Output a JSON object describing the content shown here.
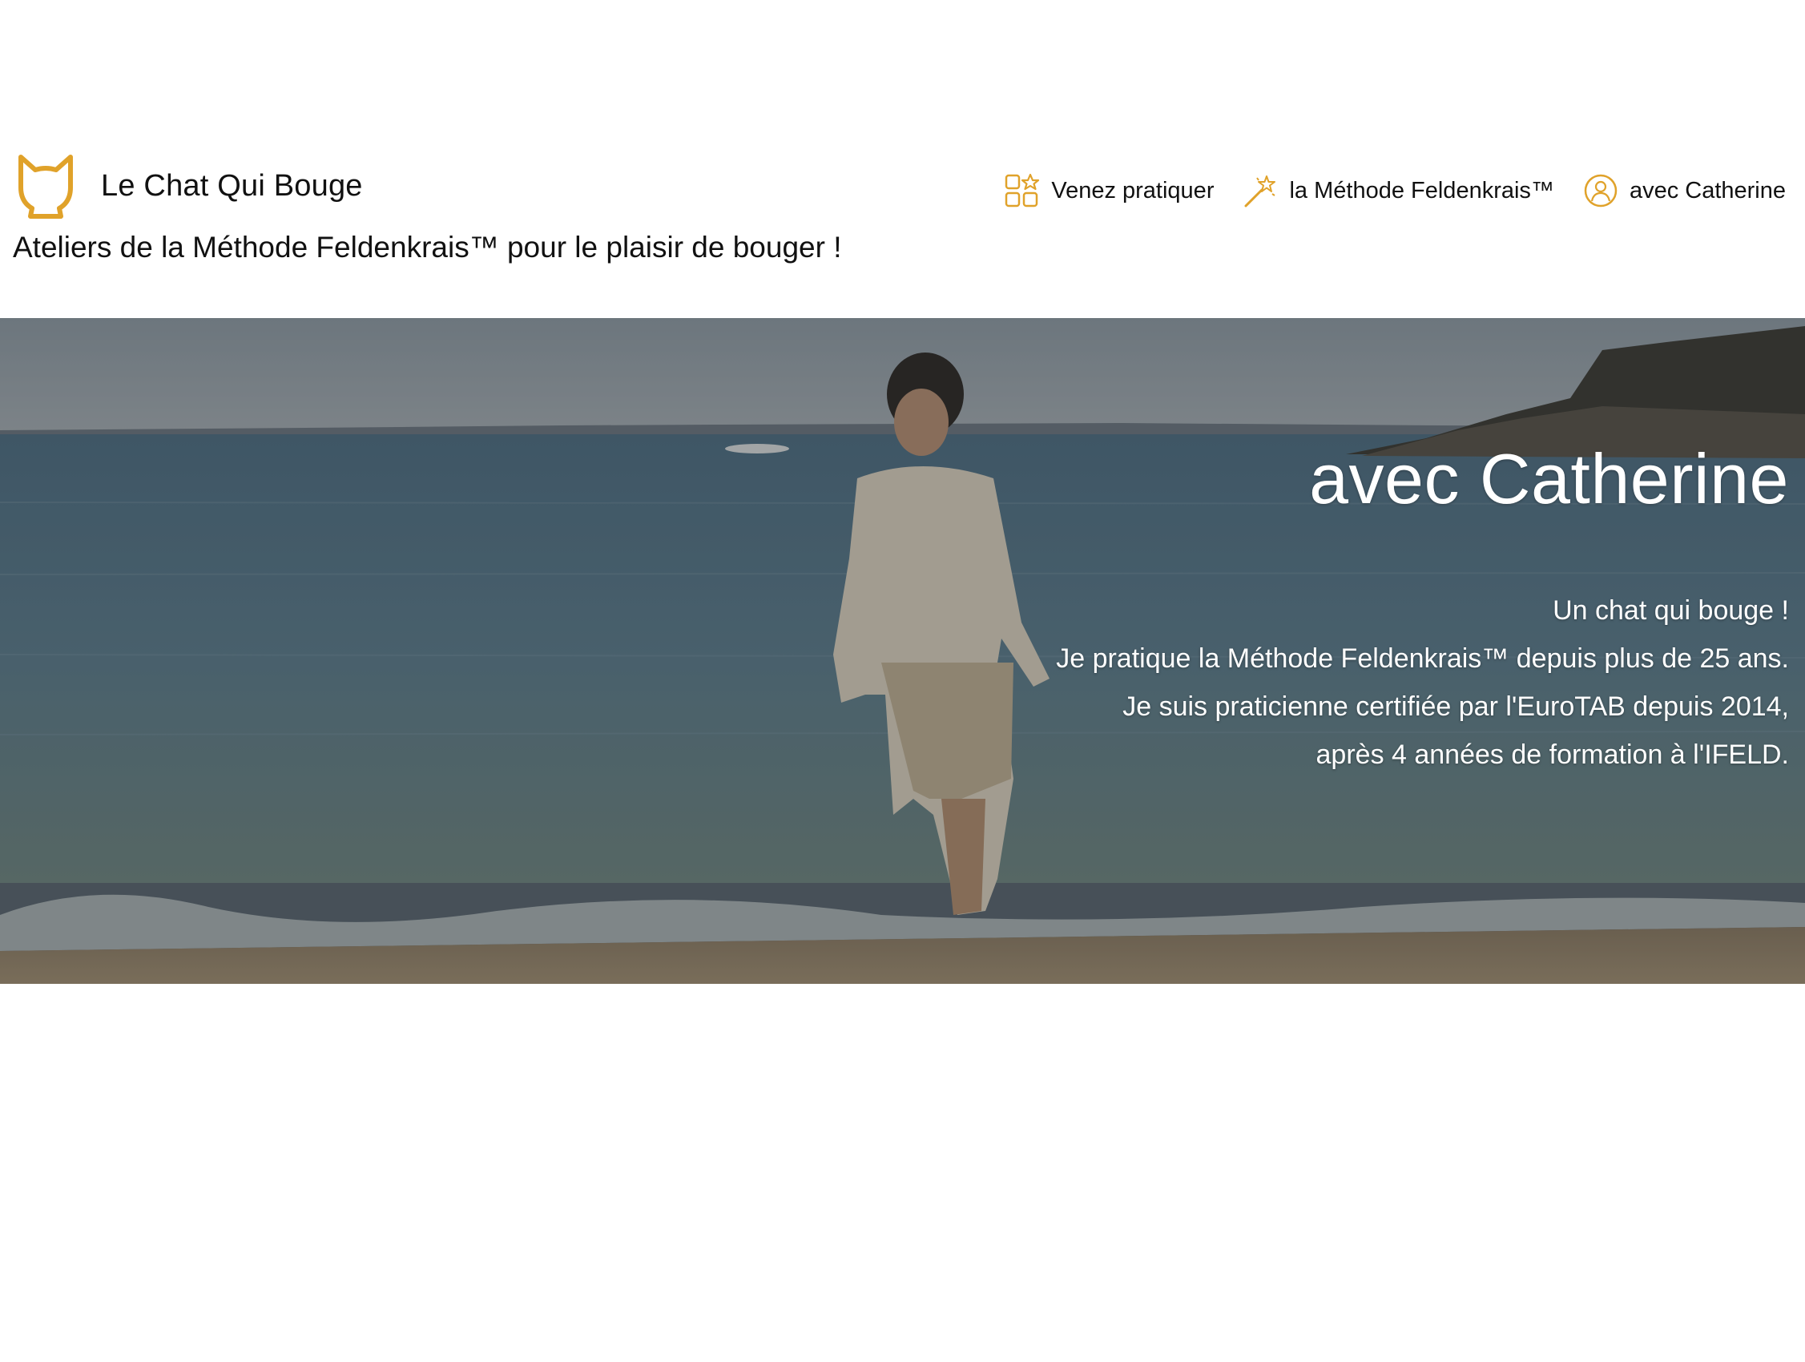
{
  "header": {
    "brand_name": "Le Chat Qui Bouge",
    "tagline": "Ateliers de la Méthode Feldenkrais™ pour le plaisir de bouger !",
    "logo_icon": "cat-head-icon",
    "accent_color": "#e0a22a"
  },
  "nav": {
    "items": [
      {
        "label": "Venez pratiquer",
        "icon": "grid-star-icon"
      },
      {
        "label": "la Méthode Feldenkrais™",
        "icon": "magic-wand-icon"
      },
      {
        "label": "avec Catherine",
        "icon": "person-circle-icon"
      }
    ]
  },
  "hero": {
    "title": "avec Catherine",
    "lines": [
      "Un chat qui bouge !",
      "Je pratique la Méthode Feldenkrais™ depuis plus de 25 ans.",
      "Je suis praticienne certifiée par l'EuroTAB depuis 2014,",
      "après 4 années de formation à l'IFELD."
    ]
  }
}
